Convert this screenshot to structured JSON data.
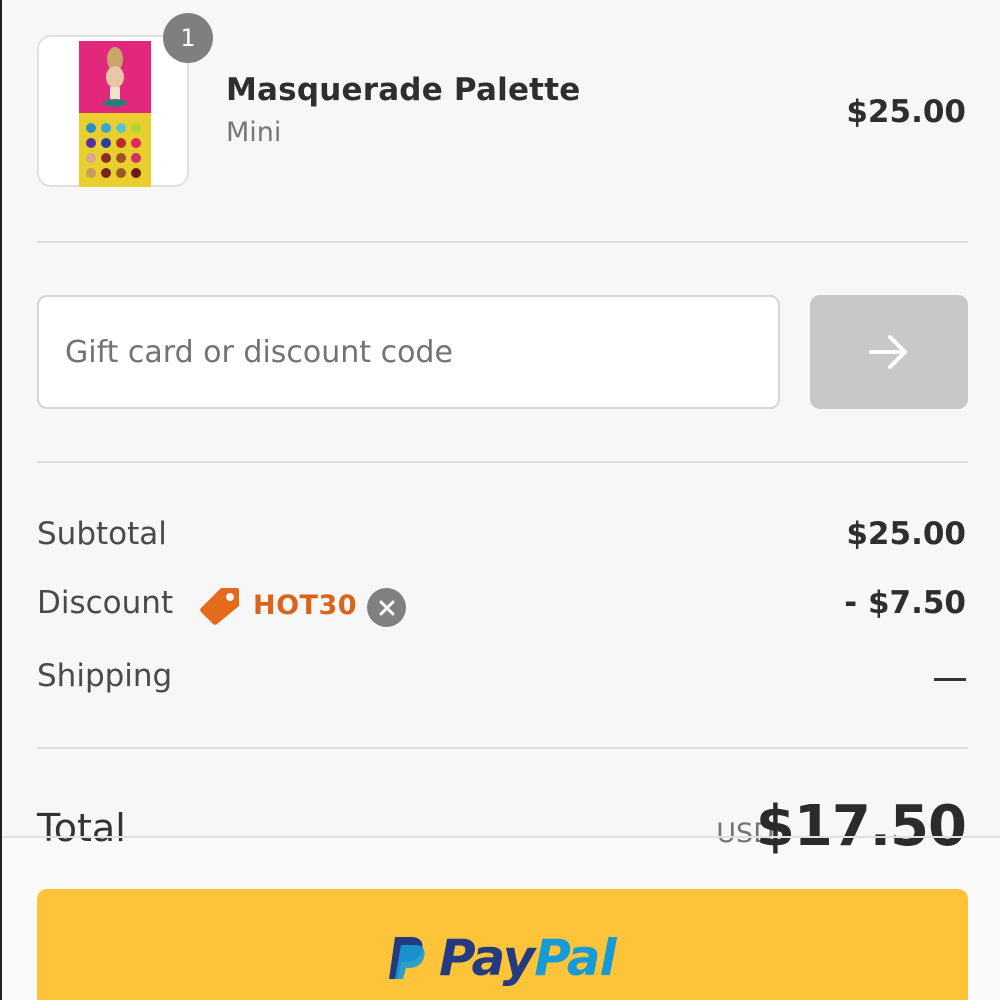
{
  "cart": {
    "item": {
      "quantity": "1",
      "name": "Masquerade Palette",
      "variant": "Mini",
      "price": "$25.00"
    }
  },
  "discount_form": {
    "placeholder": "Gift card or discount code",
    "submit_icon": "arrow-right-icon"
  },
  "summary": {
    "subtotal_label": "Subtotal",
    "subtotal_value": "$25.00",
    "discount_label": "Discount",
    "discount_code": "HOT30",
    "discount_value": "- $7.50",
    "shipping_label": "Shipping",
    "shipping_value": "—"
  },
  "total": {
    "label": "Total",
    "currency": "USD",
    "value": "$17.50"
  },
  "payment": {
    "paypal_pay": "Pay",
    "paypal_pal": "Pal"
  },
  "colors": {
    "accent": "#d9641a",
    "paypal_button": "#fdc439",
    "paypal_dark": "#253b80",
    "paypal_light": "#179bd7"
  }
}
